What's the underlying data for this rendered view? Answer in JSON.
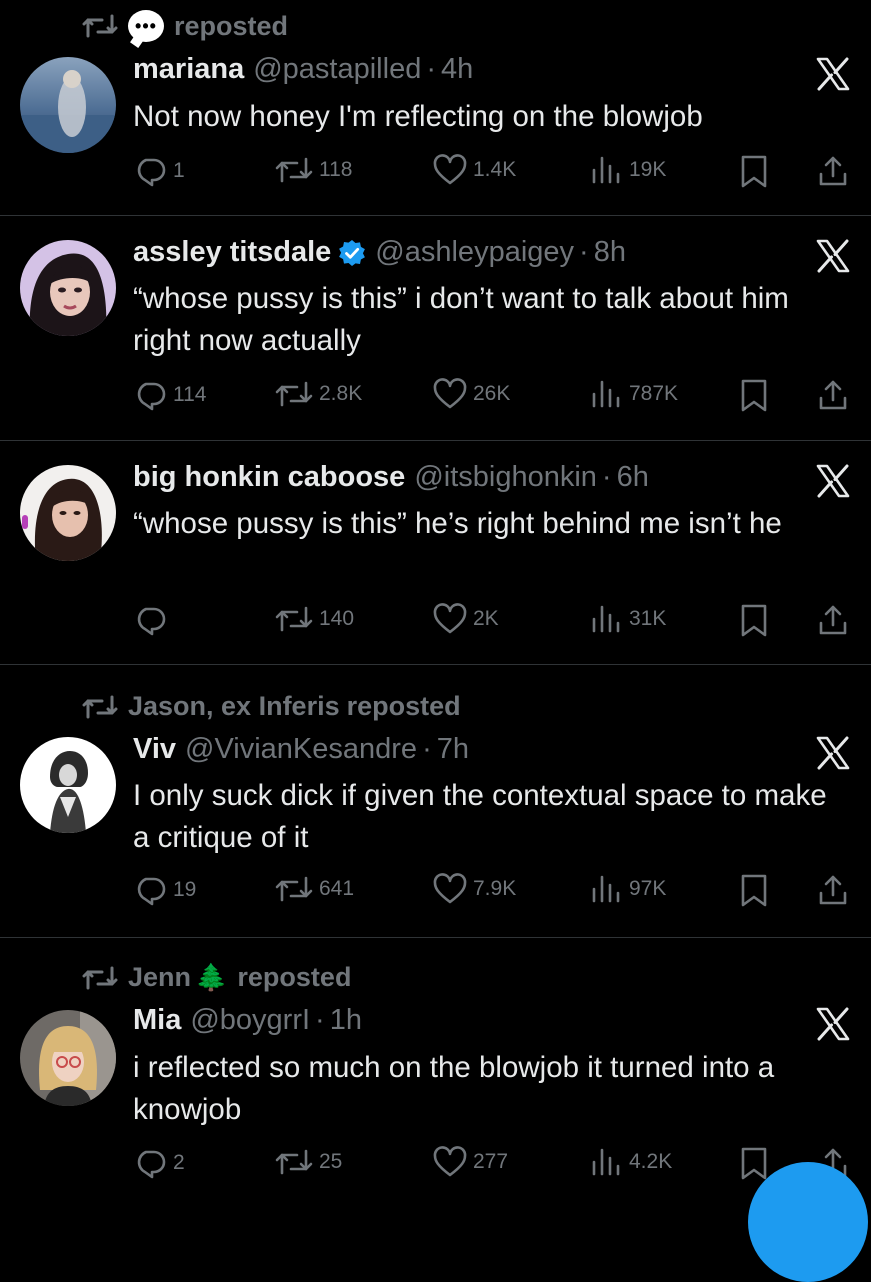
{
  "tweets": [
    {
      "repost": {
        "user": "",
        "suffix": "reposted",
        "badge": "bubble-icon",
        "badge_text": "•••"
      },
      "name": "mariana",
      "handle": "@pastapilled",
      "separator": "·",
      "time": "4h",
      "verified": false,
      "text": "Not now honey I'm reflecting on the blowjob",
      "stats": {
        "replies": "1",
        "reposts": "118",
        "likes": "1.4K",
        "views": "19K"
      }
    },
    {
      "repost": null,
      "name": "assley titsdale",
      "handle": "@ashleypaigey",
      "separator": "·",
      "time": "8h",
      "verified": true,
      "text": "“whose pussy is this” i don’t want to talk about him right now actually",
      "stats": {
        "replies": "114",
        "reposts": "2.8K",
        "likes": "26K",
        "views": "787K"
      }
    },
    {
      "repost": null,
      "name": "big honkin caboose",
      "handle": "@itsbighonkin",
      "separator": "·",
      "time": "6h",
      "verified": false,
      "text": "“whose pussy is this” he’s right behind me isn’t he",
      "stats": {
        "replies": "",
        "reposts": "140",
        "likes": "2K",
        "views": "31K"
      }
    },
    {
      "repost": {
        "user": "Jason, ex Inferis",
        "suffix": "reposted"
      },
      "name": "Viv",
      "handle": "@VivianKesandre",
      "separator": "·",
      "time": "7h",
      "verified": false,
      "text": "I only suck dick if given the contextual space to make a critique of it",
      "stats": {
        "replies": "19",
        "reposts": "641",
        "likes": "7.9K",
        "views": "97K"
      }
    },
    {
      "repost": {
        "user": "Jenn",
        "emoji": "🌲",
        "suffix": "reposted"
      },
      "name": "Mia",
      "handle": "@boygrrI",
      "separator": "·",
      "time": "1h",
      "verified": false,
      "text": "i reflected so much on the blowjob it turned into a knowjob",
      "stats": {
        "replies": "2",
        "reposts": "25",
        "likes": "277",
        "views": "4.2K"
      }
    }
  ],
  "colors": {
    "background": "#000000",
    "text": "#e7e9ea",
    "muted": "#71767b",
    "divider": "#2f3336",
    "accent": "#1d9bf0"
  }
}
